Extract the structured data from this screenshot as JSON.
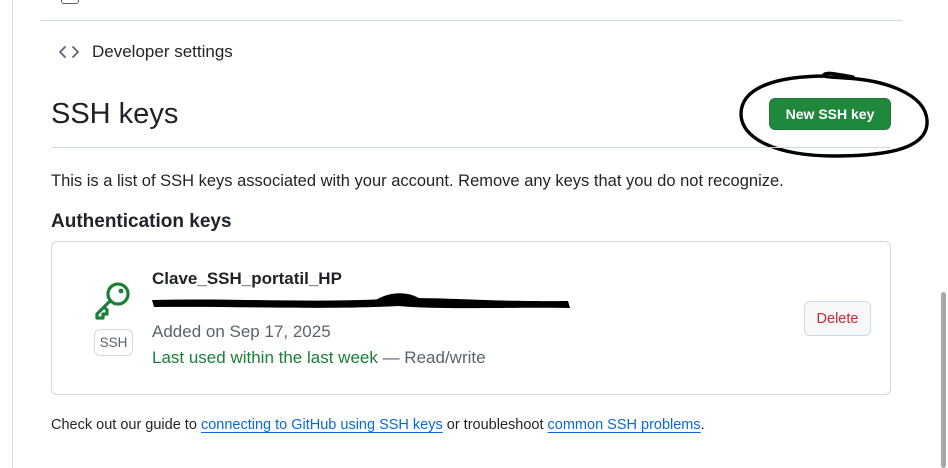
{
  "nav": {
    "developer_settings_label": "Developer settings",
    "icon": "code-icon"
  },
  "page": {
    "title": "SSH keys",
    "new_key_button": "New SSH key",
    "description": "This is a list of SSH keys associated with your account. Remove any keys that you do not recognize."
  },
  "auth_section": {
    "heading": "Authentication keys",
    "keys": [
      {
        "name": "Clave_SSH_portatil_HP",
        "badge": "SSH",
        "icon": "key-icon",
        "added": "Added on Sep 17, 2025",
        "last_used": "Last used within the last week",
        "access": " — Read/write",
        "delete_label": "Delete",
        "fingerprint_redacted": true
      }
    ]
  },
  "footer": {
    "prefix": "Check out our guide to ",
    "link1": "connecting to GitHub using SSH keys",
    "middle": " or troubleshoot ",
    "link2": "common SSH problems",
    "suffix": "."
  },
  "colors": {
    "primary_button": "#1f883d",
    "danger": "#d1242f",
    "link": "#0969da",
    "success_text": "#1a7f37",
    "annotation_ink": "#000000"
  }
}
